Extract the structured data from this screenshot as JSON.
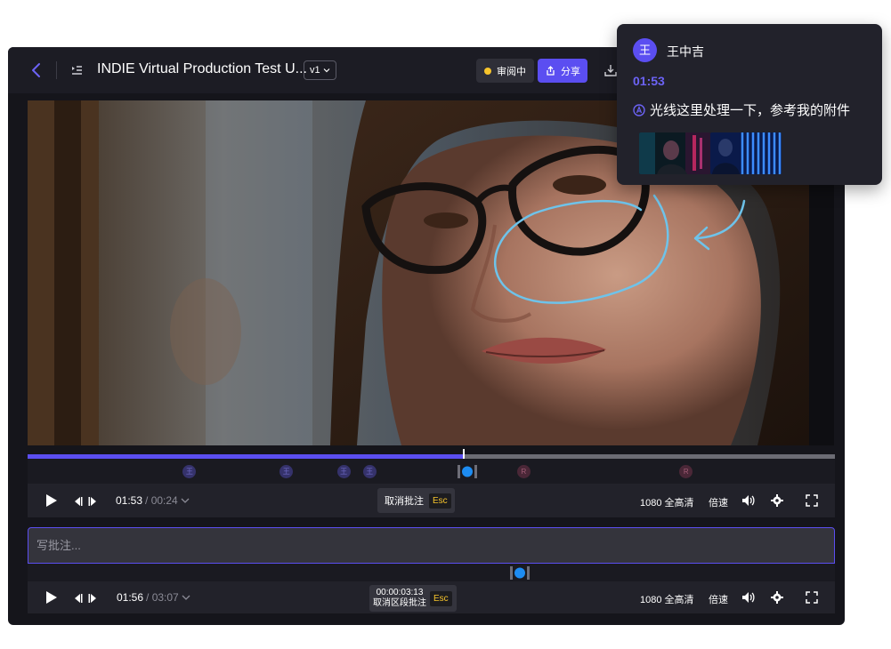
{
  "header": {
    "title": "INDIE Virtual Production Test U...",
    "version": "v1",
    "status": "审阅中",
    "share": "分享"
  },
  "player": {
    "progress_fraction": 0.54,
    "markers": [
      {
        "label": "王",
        "kind": "user",
        "pos": 0.2
      },
      {
        "label": "王",
        "kind": "user",
        "pos": 0.32
      },
      {
        "label": "王",
        "kind": "user",
        "pos": 0.391
      },
      {
        "label": "王",
        "kind": "user",
        "pos": 0.423
      },
      {
        "label": "R",
        "kind": "r",
        "pos": 0.614
      },
      {
        "label": "R",
        "kind": "r",
        "pos": 0.815
      }
    ],
    "controls_top": {
      "current_time": "01:53",
      "duration": "/ 00:24",
      "cancel_label": "取消批注",
      "esc_label": "Esc",
      "quality": "1080 全高清",
      "speed": "倍速"
    },
    "comment_placeholder": "写批注...",
    "controls_bottom": {
      "current_time": "01:56",
      "duration": "/ 03:07",
      "range_time": "00:00:03:13",
      "range_label": "取消区段批注",
      "esc_label": "Esc",
      "quality": "1080 全高清",
      "speed": "倍速"
    }
  },
  "popup": {
    "avatar_initial": "王",
    "author": "王中吉",
    "time": "01:53",
    "comment": "光线这里处理一下，参考我的附件"
  },
  "colors": {
    "accent": "#5b4ef1",
    "status_dot": "#f7c42b",
    "annotation": "#6ec3ea"
  }
}
